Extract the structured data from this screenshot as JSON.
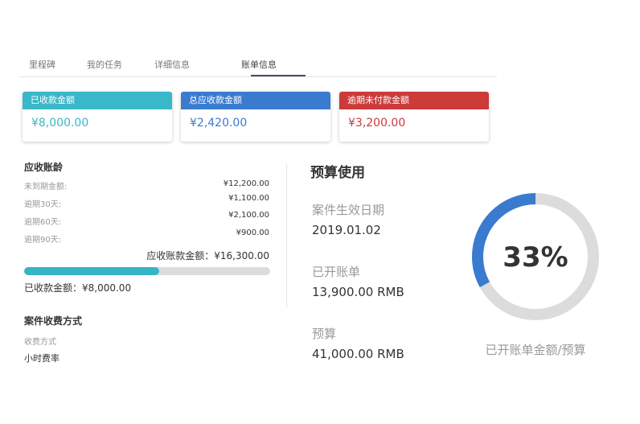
{
  "tabs": [
    "里程碑",
    "我的任务",
    "详细信息",
    "账单信息"
  ],
  "active_tab": 3,
  "cards": [
    {
      "label": "已收款金额",
      "value": "¥8,000.00",
      "color": "#3ab7c9"
    },
    {
      "label": "总应收款金额",
      "value": "¥2,420.00",
      "color": "#3a7bd0"
    },
    {
      "label": "逾期未付款金额",
      "value": "¥3,200.00",
      "color": "#cc3a3a"
    }
  ],
  "aging": {
    "title": "应收账龄",
    "rows": [
      {
        "label": "未到期金额:",
        "value": "¥12,200.00"
      },
      {
        "label": "逾期30天:",
        "value": "¥1,100.00"
      },
      {
        "label": "逾期60天:",
        "value": "¥2,100.00"
      },
      {
        "label": "逾期90天:",
        "value": "¥900.00"
      }
    ],
    "total": "应收账款金额：¥16,300.00",
    "progress_fraction": 0.55,
    "progress_color": "#37b3c6",
    "received": "已收款金额：¥8,000.00"
  },
  "billing_method": {
    "title": "案件收费方式",
    "label": "收费方式",
    "value": "小时费率"
  },
  "budget": {
    "title": "预算使用",
    "items": [
      {
        "label": "案件生效日期",
        "value": "2019.01.02"
      },
      {
        "label": "已开账单",
        "value": "13,900.00 RMB"
      },
      {
        "label": "预算",
        "value": "41,000.00 RMB"
      }
    ],
    "percent_label": "33%",
    "fraction": 0.33,
    "arc_color": "#3a7bd0",
    "track_color": "#dcdcdc",
    "caption": "已开账单金额/预算"
  }
}
